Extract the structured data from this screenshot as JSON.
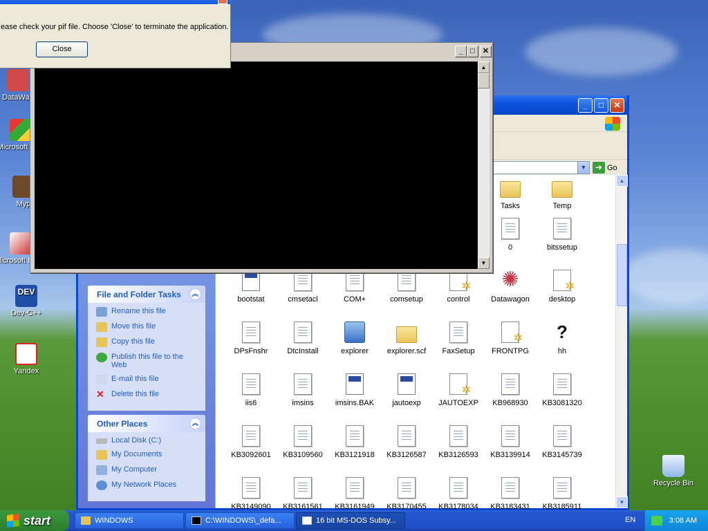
{
  "desktop": {
    "icons": [
      {
        "label": "DataWag"
      },
      {
        "label": "Microsoft C++"
      },
      {
        "label": "Myp"
      },
      {
        "label": "Microsoft Basic"
      },
      {
        "label": "Dev-C++"
      },
      {
        "label": "Yandex"
      },
      {
        "label": "Recycle Bin"
      }
    ]
  },
  "dialog": {
    "message": "ease check your pif file. Choose 'Close' to terminate the application.",
    "close_label": "Close"
  },
  "explorer": {
    "address_go": "Go",
    "panels": {
      "file_tasks": {
        "title": "File and Folder Tasks",
        "items": [
          "Rename this file",
          "Move this file",
          "Copy this file",
          "Publish this file to the Web",
          "E-mail this file",
          "Delete this file"
        ]
      },
      "other_places": {
        "title": "Other Places",
        "items": [
          "Local Disk (C:)",
          "My Documents",
          "My Computer",
          "My Network Places"
        ]
      }
    },
    "files": [
      [
        "",
        "",
        "",
        "",
        "",
        "Tasks",
        "Temp"
      ],
      [
        "",
        "",
        "",
        "",
        "",
        "0",
        "bitssetup"
      ],
      [
        "bootstat",
        "cmsetacl",
        "COM+",
        "comsetup",
        "control",
        "Datawagon",
        "desktop"
      ],
      [
        "DPsFnshr",
        "DtcInstall",
        "explorer",
        "explorer.scf",
        "FaxSetup",
        "FRONTPG",
        "hh"
      ],
      [
        "iis6",
        "imsins",
        "imsins.BAK",
        "jautoexp",
        "JAUTOEXP",
        "KB968930",
        "KB3081320"
      ],
      [
        "KB3092601",
        "KB3109560",
        "KB3121918",
        "KB3126587",
        "KB3126593",
        "KB3139914",
        "KB3145739"
      ],
      [
        "KB3149090",
        "KB3161561",
        "KB3161949",
        "KB3170455",
        "KB3178034",
        "KB3183431",
        "KB3185911"
      ]
    ]
  },
  "taskbar": {
    "start_label": "start",
    "buttons": [
      {
        "label": "WINDOWS"
      },
      {
        "label": "C:\\WINDOWS\\_defa..."
      },
      {
        "label": "16 bit MS-DOS Subsy..."
      }
    ],
    "language": "EN",
    "clock": "3:08 AM"
  },
  "colors": {
    "xp_blue": "#0a54e0",
    "link_blue": "#215dc6",
    "start_green": "#3c9a3c"
  }
}
